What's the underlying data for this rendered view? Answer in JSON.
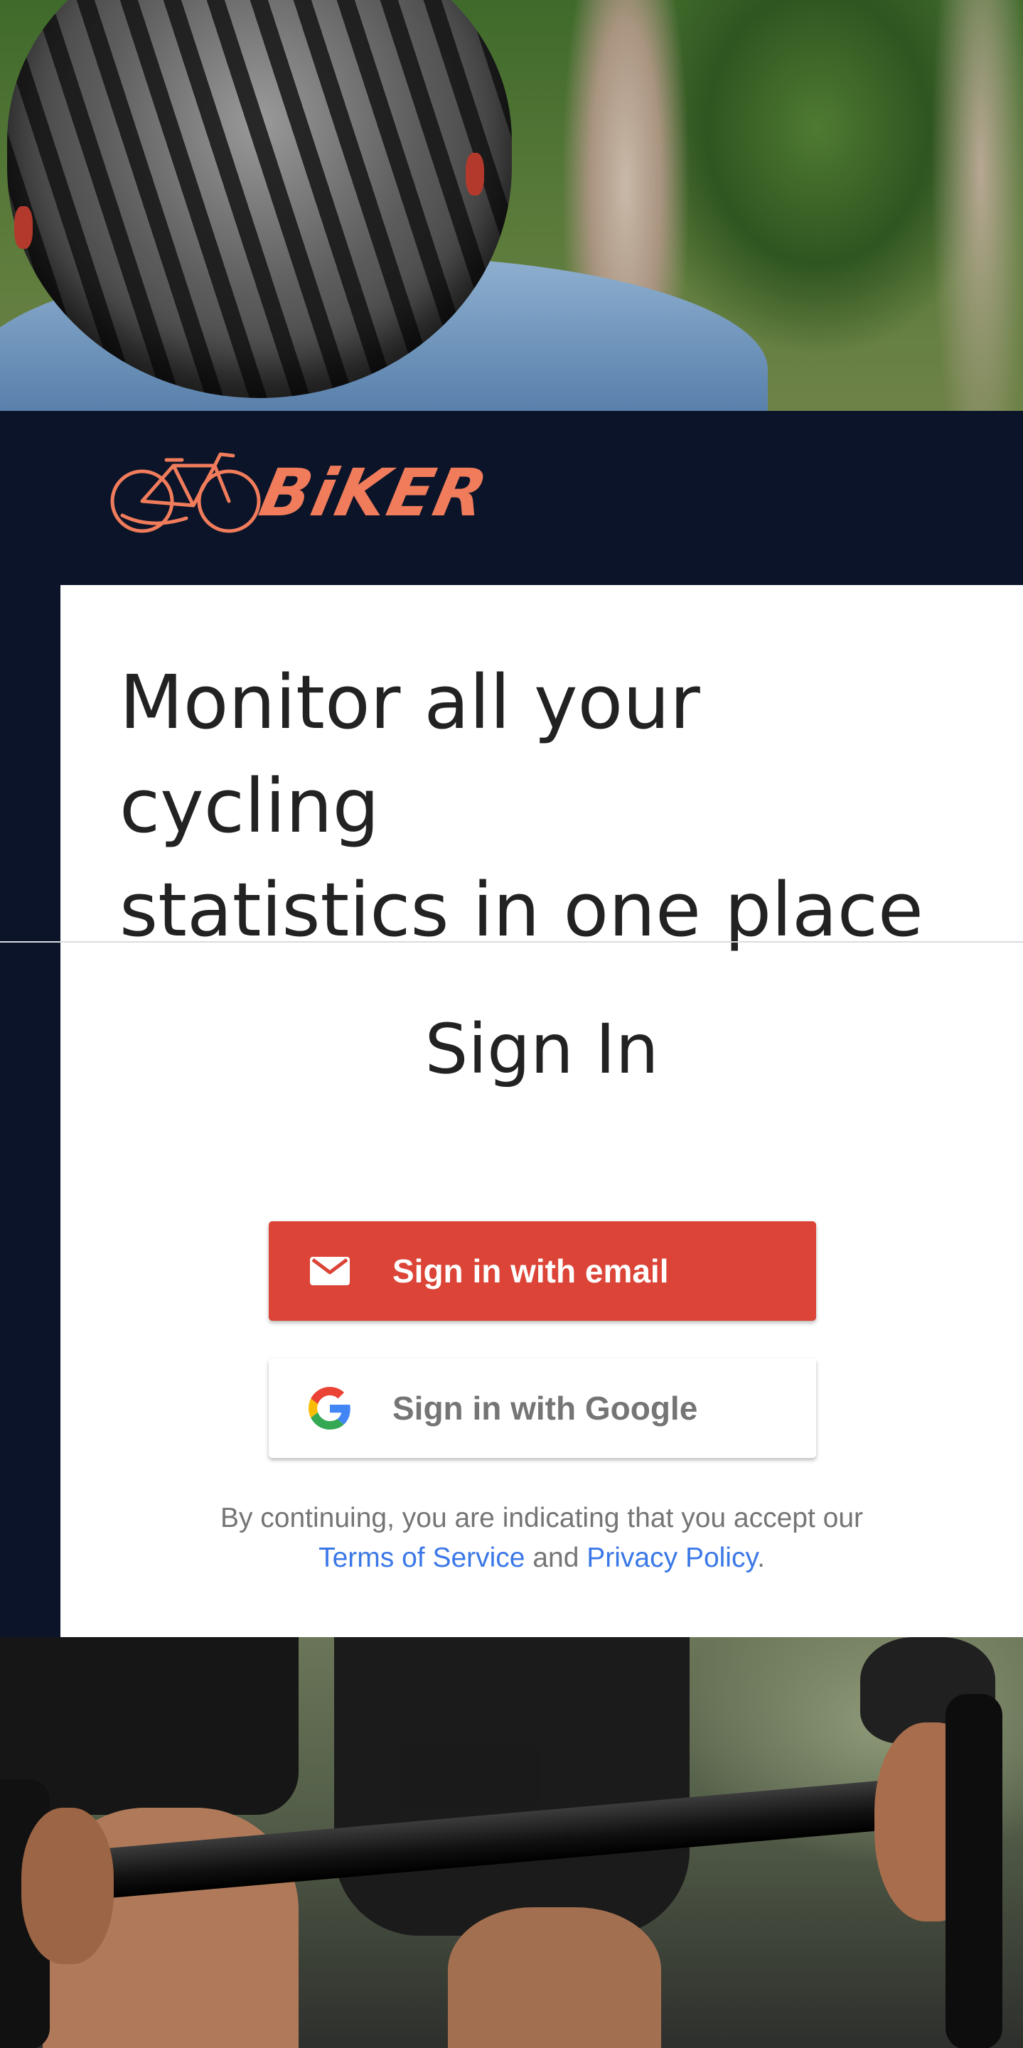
{
  "brand": {
    "name": "BiKER",
    "accent": "#f07c5c",
    "background": "#0b1428"
  },
  "hero": {
    "headline_line1": "Monitor all your cycling",
    "headline_line2": "statistics in one place"
  },
  "auth": {
    "title": "Sign In",
    "email_button": {
      "label": "Sign in with email",
      "icon": "mail-icon",
      "color": "#db4437"
    },
    "google_button": {
      "label": "Sign in with Google",
      "icon": "google-g-icon"
    },
    "disclaimer_prefix": "By continuing, you are indicating that you accept our",
    "terms_link": "Terms of Service",
    "and_text": "and",
    "privacy_link": "Privacy Policy",
    "period": ".",
    "link_color": "#3b78e7"
  }
}
